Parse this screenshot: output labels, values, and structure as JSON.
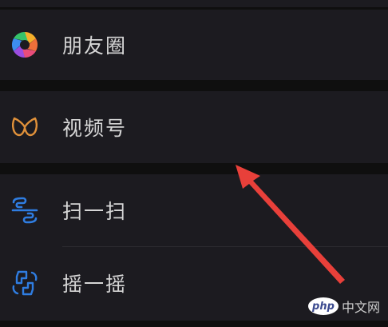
{
  "menu": {
    "moments": {
      "label": "朋友圈",
      "icon": "moments-aperture-icon"
    },
    "channels": {
      "label": "视频号",
      "icon": "channels-icon"
    },
    "scan": {
      "label": "扫一扫",
      "icon": "scan-icon"
    },
    "shake": {
      "label": "摇一摇",
      "icon": "shake-icon"
    }
  },
  "watermark": {
    "logo": "php",
    "text": "中文网"
  },
  "colors": {
    "background": "#0f0f0f",
    "row_background": "#1c1b20",
    "label": "#d6d6d6",
    "channels_icon": "#e0913a",
    "scan_shake_icon": "#2f7de1",
    "arrow": "#e8403a"
  }
}
